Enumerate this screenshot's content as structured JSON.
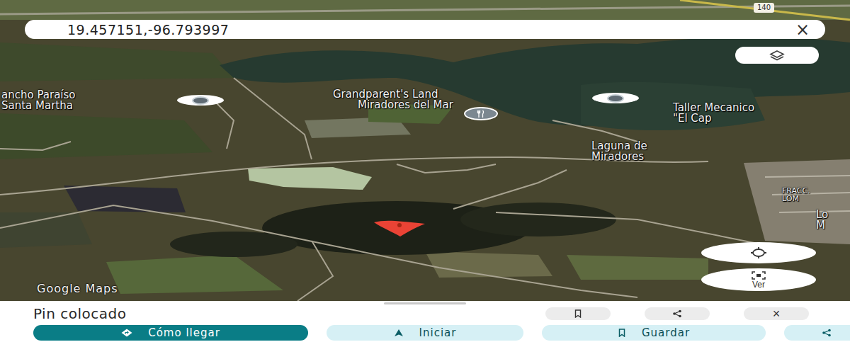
{
  "search": {
    "value": "19.457151,-96.793997",
    "clear": "×"
  },
  "map": {
    "road_badge": "140",
    "labels": [
      {
        "lines": [
          "ancho Paraíso",
          "Santa Martha"
        ],
        "kind": "place"
      },
      {
        "lines": [
          "Grandparent's Land"
        ],
        "kind": "place"
      },
      {
        "lines": [
          "Miradores del Mar"
        ],
        "kind": "restaurant"
      },
      {
        "lines": [
          "Taller Mecanico",
          "\"El Cap"
        ],
        "kind": "text"
      },
      {
        "lines": [
          "Laguna de",
          "Miradores"
        ],
        "kind": "text"
      },
      {
        "lines": [
          "FRACC.",
          "LOM"
        ],
        "kind": "text"
      },
      {
        "lines": [
          "Lo",
          "M"
        ],
        "kind": "text"
      }
    ],
    "attribution": "Google Maps",
    "view_button": "Ver"
  },
  "sheet": {
    "title": "Pin colocado",
    "actions": [
      {
        "kind": "save",
        "label": ""
      },
      {
        "kind": "share",
        "label": ""
      },
      {
        "kind": "close",
        "label": "×"
      }
    ],
    "buttons": [
      {
        "kind": "directions",
        "label": "Cómo llegar",
        "primary": true
      },
      {
        "kind": "start",
        "label": "Iniciar",
        "primary": false
      },
      {
        "kind": "save",
        "label": "Guardar",
        "primary": false
      },
      {
        "kind": "share",
        "label": "",
        "primary": false
      }
    ]
  }
}
